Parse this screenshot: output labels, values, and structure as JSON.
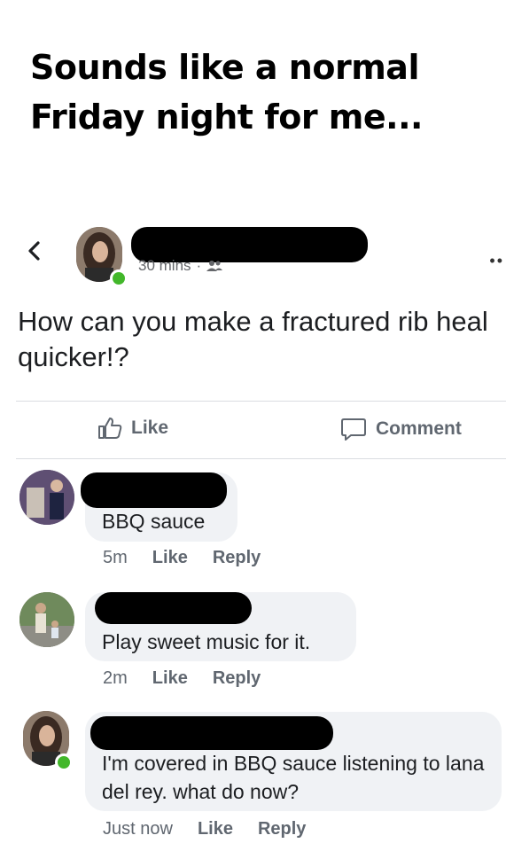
{
  "caption": "Sounds like a normal Friday night for me...",
  "post": {
    "time": "30 mins",
    "separator": "·",
    "audience_icon": "friends-icon",
    "question": "How can you make a fractured rib heal quicker!?",
    "like_label": "Like",
    "comment_label": "Comment"
  },
  "comments": [
    {
      "text": "BBQ sauce",
      "time": "5m",
      "like": "Like",
      "reply": "Reply"
    },
    {
      "text": "Play sweet music for it.",
      "time": "2m",
      "like": "Like",
      "reply": "Reply"
    },
    {
      "text": "I'm covered in BBQ sauce listening to lana del rey. what do now?",
      "time": "Just now",
      "like": "Like",
      "reply": "Reply"
    }
  ],
  "colors": {
    "online": "#42b72a",
    "bubble": "#f0f2f5",
    "meta": "#606770"
  }
}
